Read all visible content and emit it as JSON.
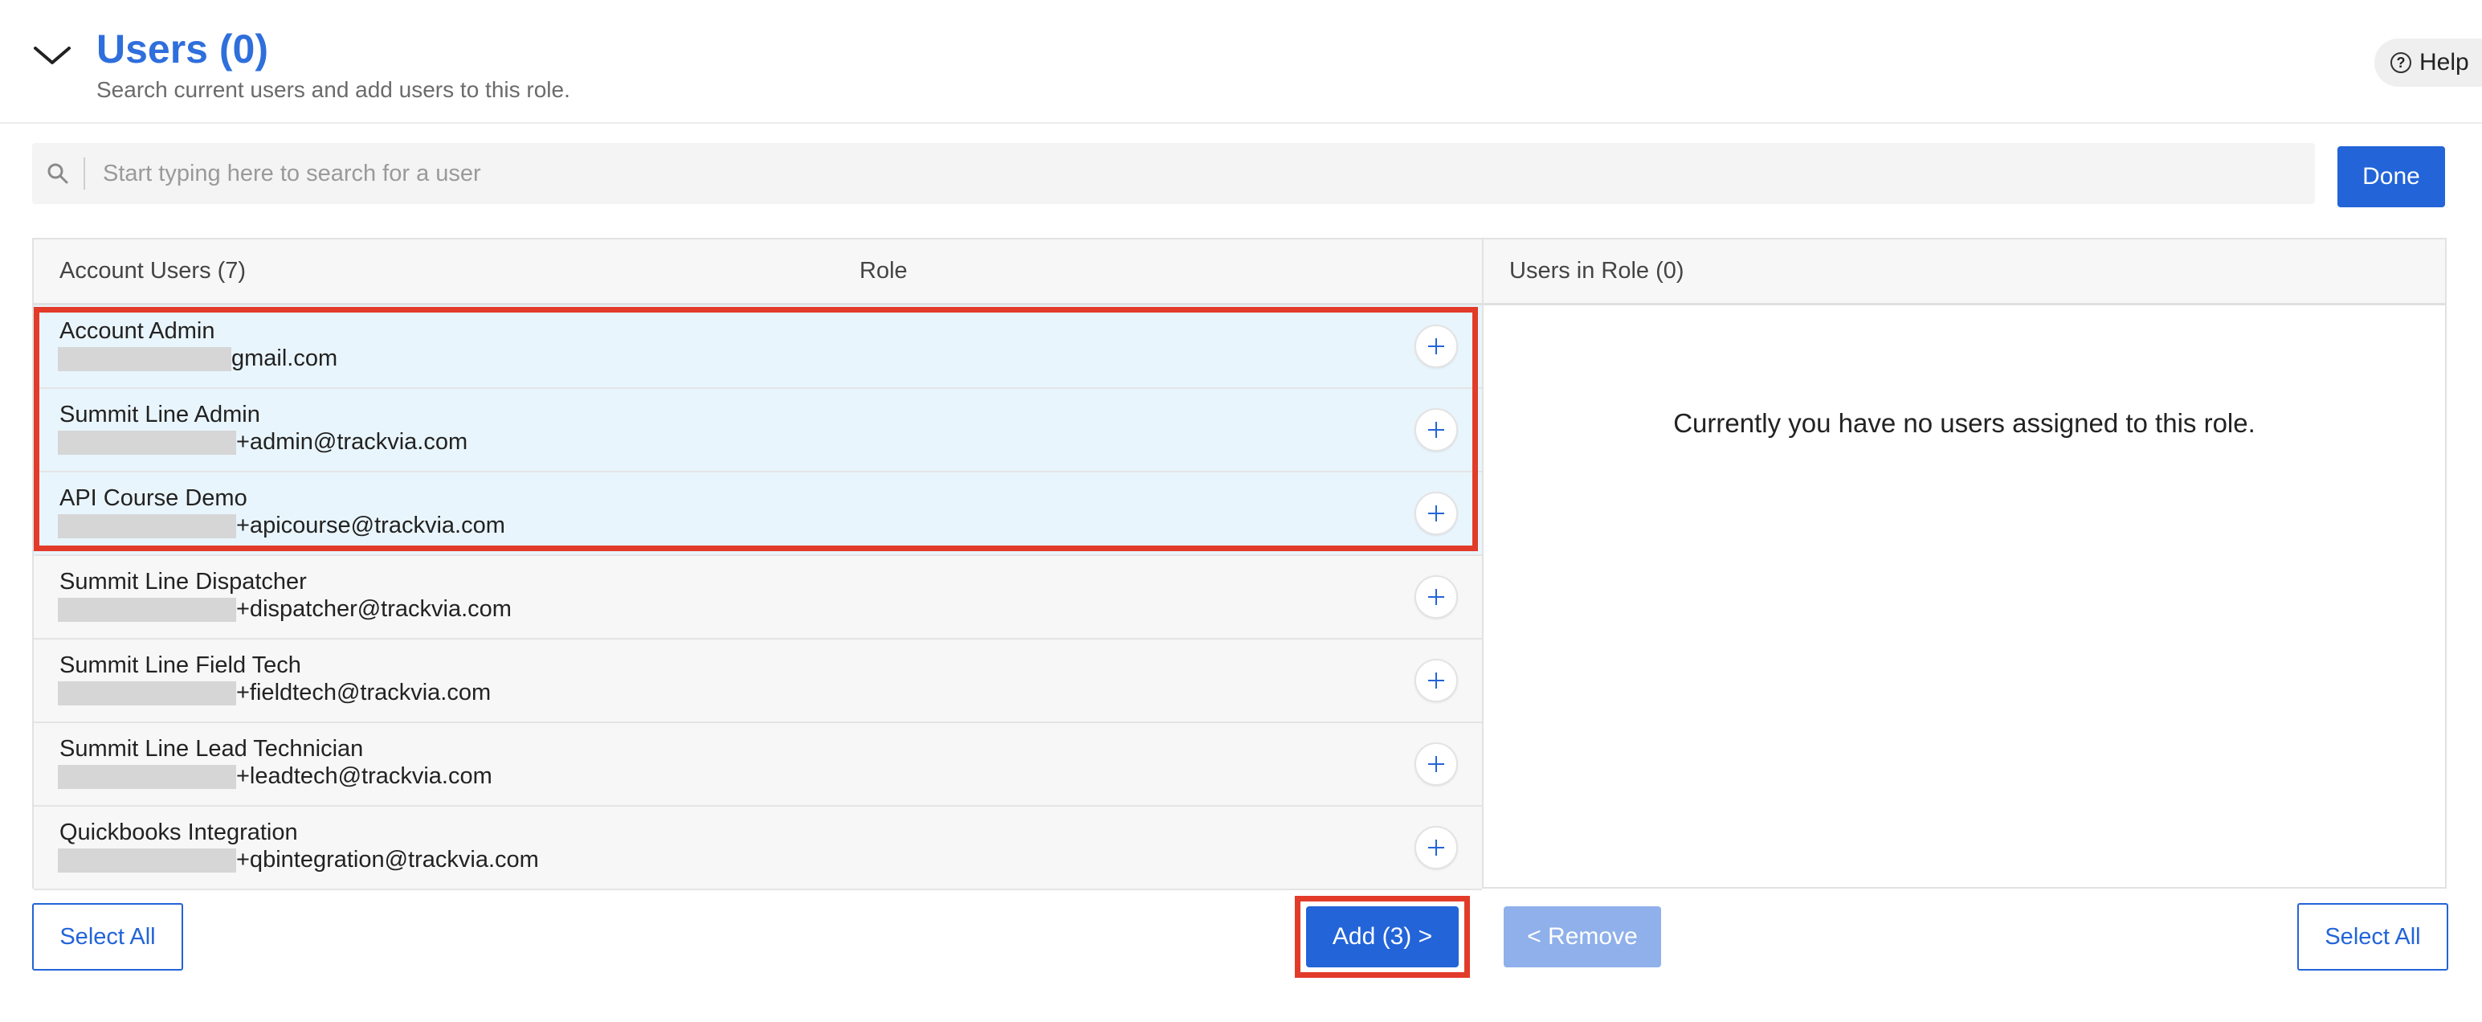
{
  "header": {
    "title": "Users (0)",
    "subtitle": "Search current users and add users to this role.",
    "help_label": "Help"
  },
  "search": {
    "placeholder": "Start typing here to search for a user"
  },
  "done_label": "Done",
  "account_users": {
    "header": "Account Users (7)",
    "role_header": "Role",
    "users": [
      {
        "name": "Account Admin",
        "email": "gmail.com",
        "selected": true
      },
      {
        "name": "Summit Line Admin",
        "email": "+admin@trackvia.com",
        "selected": true
      },
      {
        "name": "API Course Demo",
        "email": "+apicourse@trackvia.com",
        "selected": true
      },
      {
        "name": "Summit Line Dispatcher",
        "email": "+dispatcher@trackvia.com",
        "selected": false
      },
      {
        "name": "Summit Line Field Tech",
        "email": "+fieldtech@trackvia.com",
        "selected": false
      },
      {
        "name": "Summit Line Lead Technician",
        "email": "+leadtech@trackvia.com",
        "selected": false
      },
      {
        "name": "Quickbooks Integration",
        "email": "+qbintegration@trackvia.com",
        "selected": false
      }
    ]
  },
  "role_users": {
    "header": "Users in Role (0)",
    "empty_message": "Currently you have no users assigned to this role."
  },
  "footer": {
    "select_all_left": "Select All",
    "add_label": "Add (3) >",
    "remove_label": "< Remove",
    "select_all_right": "Select All"
  },
  "colors": {
    "accent": "#2364d8",
    "title": "#2f6fdc",
    "selected_row": "#e9f5fc",
    "highlight": "#e23b2a"
  }
}
